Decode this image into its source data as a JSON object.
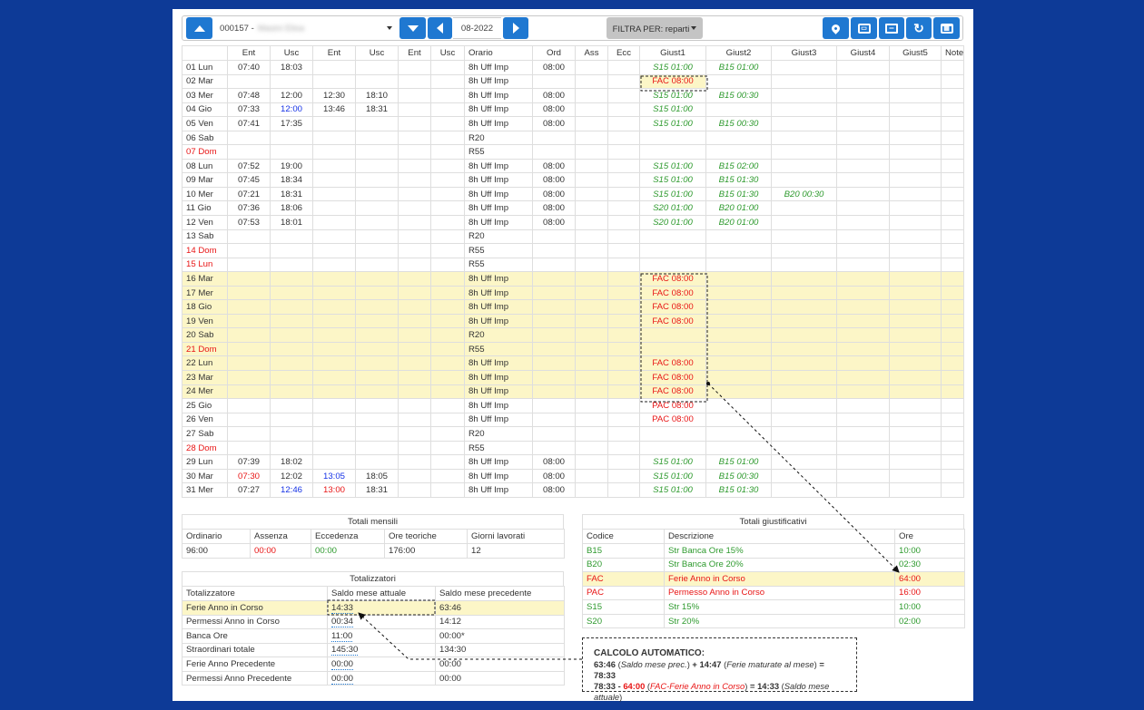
{
  "toolbar": {
    "employee": "000157 -",
    "employee_hidden": "Masini Elisa",
    "month": "08-2022",
    "filter": "FILTRA PER: reparti"
  },
  "columns": [
    "",
    "Ent",
    "Usc",
    "Ent",
    "Usc",
    "Ent",
    "Usc",
    "Orario",
    "Ord",
    "Ass",
    "Ecc",
    "Giust1",
    "Giust2",
    "Giust3",
    "Giust4",
    "Giust5",
    "Note"
  ],
  "rows": [
    {
      "d": "01 Lun",
      "t": [
        "07:40",
        "18:03",
        "",
        "",
        "",
        ""
      ],
      "o": "8h Uff Imp",
      "ord": "08:00",
      "g": [
        "S15 01:00",
        "B15 01:00",
        ""
      ]
    },
    {
      "d": "02 Mar",
      "t": [
        "",
        "",
        "",
        "",
        "",
        ""
      ],
      "o": "8h Uff Imp",
      "ord": "",
      "g": [
        "FAC 08:00",
        "",
        ""
      ]
    },
    {
      "d": "03 Mer",
      "t": [
        "07:48",
        "12:00",
        "12:30",
        "18:10",
        "",
        ""
      ],
      "o": "8h Uff Imp",
      "ord": "08:00",
      "g": [
        "S15 01:00",
        "B15 00:30",
        ""
      ]
    },
    {
      "d": "04 Gio",
      "t": [
        "07:33",
        "12:00",
        "13:46",
        "18:31",
        "",
        ""
      ],
      "o": "8h Uff Imp",
      "ord": "08:00",
      "g": [
        "S15 01:00",
        "",
        ""
      ]
    },
    {
      "d": "05 Ven",
      "t": [
        "07:41",
        "17:35",
        "",
        "",
        "",
        ""
      ],
      "o": "8h Uff Imp",
      "ord": "08:00",
      "g": [
        "S15 01:00",
        "B15 00:30",
        ""
      ]
    },
    {
      "d": "06 Sab",
      "t": [
        "",
        "",
        "",
        "",
        "",
        ""
      ],
      "o": "R20",
      "ord": "",
      "g": [
        "",
        "",
        ""
      ]
    },
    {
      "d": "07 Dom",
      "t": [
        "",
        "",
        "",
        "",
        "",
        ""
      ],
      "o": "R55",
      "ord": "",
      "g": [
        "",
        "",
        ""
      ]
    },
    {
      "d": "08 Lun",
      "t": [
        "07:52",
        "19:00",
        "",
        "",
        "",
        ""
      ],
      "o": "8h Uff Imp",
      "ord": "08:00",
      "g": [
        "S15 01:00",
        "B15 02:00",
        ""
      ]
    },
    {
      "d": "09 Mar",
      "t": [
        "07:45",
        "18:34",
        "",
        "",
        "",
        ""
      ],
      "o": "8h Uff Imp",
      "ord": "08:00",
      "g": [
        "S15 01:00",
        "B15 01:30",
        ""
      ]
    },
    {
      "d": "10 Mer",
      "t": [
        "07:21",
        "18:31",
        "",
        "",
        "",
        ""
      ],
      "o": "8h Uff Imp",
      "ord": "08:00",
      "g": [
        "S15 01:00",
        "B15 01:30",
        "B20 00:30"
      ]
    },
    {
      "d": "11 Gio",
      "t": [
        "07:36",
        "18:06",
        "",
        "",
        "",
        ""
      ],
      "o": "8h Uff Imp",
      "ord": "08:00",
      "g": [
        "S20 01:00",
        "B20 01:00",
        ""
      ]
    },
    {
      "d": "12 Ven",
      "t": [
        "07:53",
        "18:01",
        "",
        "",
        "",
        ""
      ],
      "o": "8h Uff Imp",
      "ord": "08:00",
      "g": [
        "S20 01:00",
        "B20 01:00",
        ""
      ]
    },
    {
      "d": "13 Sab",
      "t": [
        "",
        "",
        "",
        "",
        "",
        ""
      ],
      "o": "R20",
      "ord": "",
      "g": [
        "",
        "",
        ""
      ]
    },
    {
      "d": "14 Dom",
      "t": [
        "",
        "",
        "",
        "",
        "",
        ""
      ],
      "o": "R55",
      "ord": "",
      "g": [
        "",
        "",
        ""
      ]
    },
    {
      "d": "15 Lun",
      "t": [
        "",
        "",
        "",
        "",
        "",
        ""
      ],
      "o": "R55",
      "ord": "",
      "g": [
        "",
        "",
        ""
      ]
    },
    {
      "d": "16 Mar",
      "t": [
        "",
        "",
        "",
        "",
        "",
        ""
      ],
      "o": "8h Uff Imp",
      "ord": "",
      "g": [
        "FAC 08:00",
        "",
        ""
      ]
    },
    {
      "d": "17 Mer",
      "t": [
        "",
        "",
        "",
        "",
        "",
        ""
      ],
      "o": "8h Uff Imp",
      "ord": "",
      "g": [
        "FAC 08:00",
        "",
        ""
      ]
    },
    {
      "d": "18 Gio",
      "t": [
        "",
        "",
        "",
        "",
        "",
        ""
      ],
      "o": "8h Uff Imp",
      "ord": "",
      "g": [
        "FAC 08:00",
        "",
        ""
      ]
    },
    {
      "d": "19 Ven",
      "t": [
        "",
        "",
        "",
        "",
        "",
        ""
      ],
      "o": "8h Uff Imp",
      "ord": "",
      "g": [
        "FAC 08:00",
        "",
        ""
      ]
    },
    {
      "d": "20 Sab",
      "t": [
        "",
        "",
        "",
        "",
        "",
        ""
      ],
      "o": "R20",
      "ord": "",
      "g": [
        "",
        "",
        ""
      ]
    },
    {
      "d": "21 Dom",
      "t": [
        "",
        "",
        "",
        "",
        "",
        ""
      ],
      "o": "R55",
      "ord": "",
      "g": [
        "",
        "",
        ""
      ]
    },
    {
      "d": "22 Lun",
      "t": [
        "",
        "",
        "",
        "",
        "",
        ""
      ],
      "o": "8h Uff Imp",
      "ord": "",
      "g": [
        "FAC 08:00",
        "",
        ""
      ]
    },
    {
      "d": "23 Mar",
      "t": [
        "",
        "",
        "",
        "",
        "",
        ""
      ],
      "o": "8h Uff Imp",
      "ord": "",
      "g": [
        "FAC 08:00",
        "",
        ""
      ]
    },
    {
      "d": "24 Mer",
      "t": [
        "",
        "",
        "",
        "",
        "",
        ""
      ],
      "o": "8h Uff Imp",
      "ord": "",
      "g": [
        "FAC 08:00",
        "",
        ""
      ]
    },
    {
      "d": "25 Gio",
      "t": [
        "",
        "",
        "",
        "",
        "",
        ""
      ],
      "o": "8h Uff Imp",
      "ord": "",
      "g": [
        "PAC 08:00",
        "",
        ""
      ]
    },
    {
      "d": "26 Ven",
      "t": [
        "",
        "",
        "",
        "",
        "",
        ""
      ],
      "o": "8h Uff Imp",
      "ord": "",
      "g": [
        "PAC 08:00",
        "",
        ""
      ]
    },
    {
      "d": "27 Sab",
      "t": [
        "",
        "",
        "",
        "",
        "",
        ""
      ],
      "o": "R20",
      "ord": "",
      "g": [
        "",
        "",
        ""
      ]
    },
    {
      "d": "28 Dom",
      "t": [
        "",
        "",
        "",
        "",
        "",
        ""
      ],
      "o": "R55",
      "ord": "",
      "g": [
        "",
        "",
        ""
      ]
    },
    {
      "d": "29 Lun",
      "t": [
        "07:39",
        "18:02",
        "",
        "",
        "",
        ""
      ],
      "o": "8h Uff Imp",
      "ord": "08:00",
      "g": [
        "S15 01:00",
        "B15 01:00",
        ""
      ]
    },
    {
      "d": "30 Mar",
      "t": [
        "07:30",
        "12:02",
        "13:05",
        "18:05",
        "",
        ""
      ],
      "o": "8h Uff Imp",
      "ord": "08:00",
      "g": [
        "S15 01:00",
        "B15 00:30",
        ""
      ]
    },
    {
      "d": "31 Mer",
      "t": [
        "07:27",
        "12:46",
        "13:00",
        "18:31",
        "",
        ""
      ],
      "o": "8h Uff Imp",
      "ord": "08:00",
      "g": [
        "S15 01:00",
        "B15 01:30",
        ""
      ]
    }
  ],
  "totali_mensili": {
    "title": "Totali mensili",
    "headers": [
      "Ordinario",
      "Assenza",
      "Eccedenza",
      "Ore teoriche",
      "Giorni lavorati"
    ],
    "values": [
      "96:00",
      "00:00",
      "00:00",
      "176:00",
      "12"
    ]
  },
  "totalizzatori": {
    "title": "Totalizzatori",
    "headers": [
      "Totalizzatore",
      "Saldo mese attuale",
      "Saldo mese precedente"
    ],
    "rows": [
      [
        "Ferie Anno in Corso",
        "14:33",
        "63:46"
      ],
      [
        "Permessi Anno in Corso",
        "00:34",
        "14:12"
      ],
      [
        "Banca Ore",
        "11:00",
        "00:00*"
      ],
      [
        "Straordinari totale",
        "145:30",
        "134:30"
      ],
      [
        "Ferie Anno Precedente",
        "00:00",
        "00:00"
      ],
      [
        "Permessi Anno Precedente",
        "00:00",
        "00:00"
      ]
    ]
  },
  "totali_giust": {
    "title": "Totali giustificativi",
    "headers": [
      "Codice",
      "Descrizione",
      "Ore"
    ],
    "rows": [
      [
        "B15",
        "Str Banca Ore 15%",
        "10:00"
      ],
      [
        "B20",
        "Str Banca Ore 20%",
        "02:30"
      ],
      [
        "FAC",
        "Ferie Anno in Corso",
        "64:00"
      ],
      [
        "PAC",
        "Permesso Anno in Corso",
        "16:00"
      ],
      [
        "S15",
        "Str 15%",
        "10:00"
      ],
      [
        "S20",
        "Str 20%",
        "02:00"
      ]
    ]
  },
  "calc": {
    "title": "CALCOLO AUTOMATICO:",
    "l1a": "63:46",
    "l1b": "Saldo mese prec.",
    "l1c": "+ 14:47",
    "l1d": "Ferie maturate al mese",
    "l1e": "= 78:33",
    "l2a": "78:33 -",
    "l2b": "64:00",
    "l2c": "FAC-Ferie Anno in Corso",
    "l2d": "=",
    "l2e": "14:33",
    "l2f": "Saldo mese attuale"
  },
  "colors": {
    "bg": "#0d3a97",
    "btn": "#1f78d1",
    "highlight": "#fcf6c7",
    "red": "#e81515",
    "green": "#2e9a2e",
    "blue": "#1431e6"
  }
}
